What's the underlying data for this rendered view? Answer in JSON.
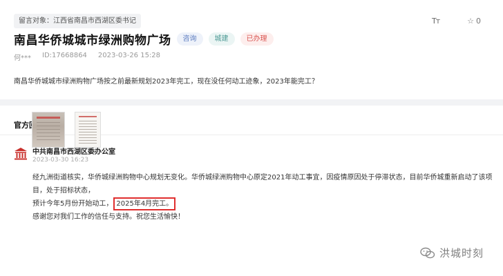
{
  "message": {
    "target_label": "留言对象：江西省南昌市西湖区委书记",
    "title": "南昌华侨城城市绿洲购物广场",
    "tags": [
      "咨询",
      "城建",
      "已办理"
    ],
    "author": "何***",
    "id_text": "ID:17668864",
    "time": "2023-03-26 15:28",
    "content": "南昌华侨城城市绿洲购物广场按之前最新规划2023年完工，现在没任何动工迹象，2023年能完工？",
    "font_tool": "Tт",
    "favorite_count": "0"
  },
  "official_reply": {
    "section_title": "官方回复",
    "org_name": "中共南昌市西湖区委办公室",
    "time": "2023-03-30 16:23",
    "line1": "经九洲街道核实，华侨城绿洲购物中心规划无变化。华侨城绿洲购物中心原定2021年动工事宜，因疫情原因处于停滞状态，目前华侨城重新启动了该项目，处于招标状态，",
    "line2_prefix": "预计今年5月份开始动工，",
    "line2_highlight": "2025年4月完工。",
    "line3": "感谢您对我们工作的信任与支持。祝您生活愉快！"
  },
  "watermark": {
    "text": "洪城时刻",
    "icon": "wechat-icon"
  },
  "colors": {
    "highlight_box": "#e02d2d",
    "tag_blue": "#5a7bbf",
    "tag_teal": "#4e9a95",
    "tag_red": "#d9534f"
  }
}
